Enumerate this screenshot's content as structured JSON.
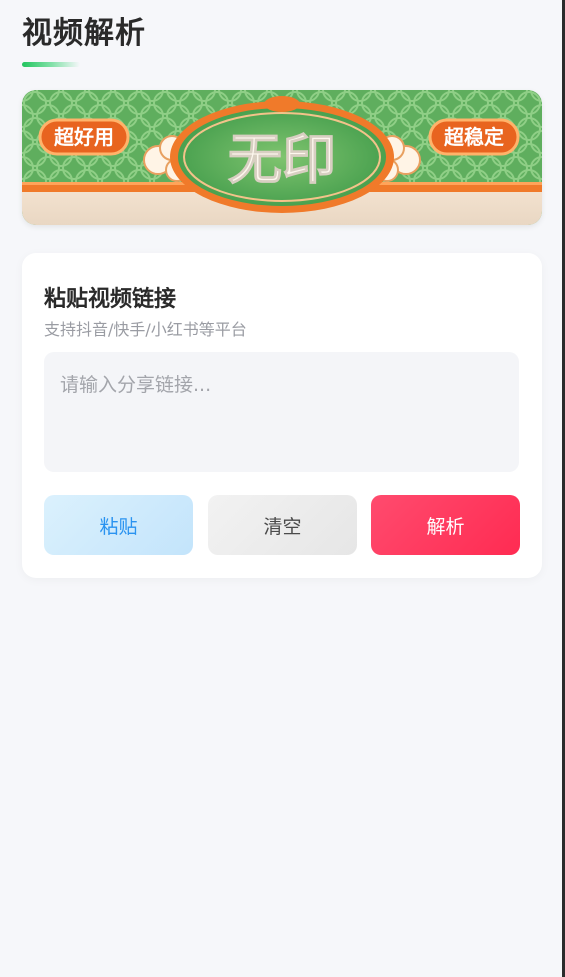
{
  "page": {
    "title": "视频解析"
  },
  "banner": {
    "left_tag": "超好用",
    "center_text": "无印",
    "right_tag": "超稳定",
    "colors": {
      "green": "#5aae5c",
      "orange": "#f07a2a",
      "cream": "#f5e6d2"
    }
  },
  "card": {
    "title": "粘贴视频链接",
    "subtitle": "支持抖音/快手/小红书等平台",
    "input": {
      "value": "",
      "placeholder": "请输入分享链接..."
    },
    "buttons": {
      "paste": "粘贴",
      "clear": "清空",
      "parse": "解析"
    }
  },
  "colors": {
    "accent_green": "#22c55e",
    "parse_red": "#ff3a5f",
    "paste_blue": "#2a93f0"
  }
}
